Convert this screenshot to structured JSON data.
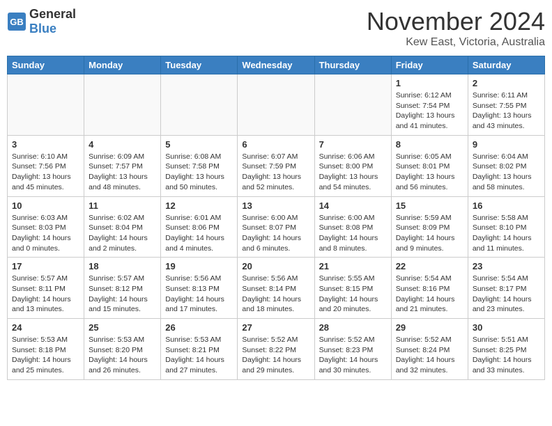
{
  "header": {
    "logo_general": "General",
    "logo_blue": "Blue",
    "month": "November 2024",
    "location": "Kew East, Victoria, Australia"
  },
  "days_of_week": [
    "Sunday",
    "Monday",
    "Tuesday",
    "Wednesday",
    "Thursday",
    "Friday",
    "Saturday"
  ],
  "weeks": [
    [
      {
        "day": "",
        "info": ""
      },
      {
        "day": "",
        "info": ""
      },
      {
        "day": "",
        "info": ""
      },
      {
        "day": "",
        "info": ""
      },
      {
        "day": "",
        "info": ""
      },
      {
        "day": "1",
        "info": "Sunrise: 6:12 AM\nSunset: 7:54 PM\nDaylight: 13 hours\nand 41 minutes."
      },
      {
        "day": "2",
        "info": "Sunrise: 6:11 AM\nSunset: 7:55 PM\nDaylight: 13 hours\nand 43 minutes."
      }
    ],
    [
      {
        "day": "3",
        "info": "Sunrise: 6:10 AM\nSunset: 7:56 PM\nDaylight: 13 hours\nand 45 minutes."
      },
      {
        "day": "4",
        "info": "Sunrise: 6:09 AM\nSunset: 7:57 PM\nDaylight: 13 hours\nand 48 minutes."
      },
      {
        "day": "5",
        "info": "Sunrise: 6:08 AM\nSunset: 7:58 PM\nDaylight: 13 hours\nand 50 minutes."
      },
      {
        "day": "6",
        "info": "Sunrise: 6:07 AM\nSunset: 7:59 PM\nDaylight: 13 hours\nand 52 minutes."
      },
      {
        "day": "7",
        "info": "Sunrise: 6:06 AM\nSunset: 8:00 PM\nDaylight: 13 hours\nand 54 minutes."
      },
      {
        "day": "8",
        "info": "Sunrise: 6:05 AM\nSunset: 8:01 PM\nDaylight: 13 hours\nand 56 minutes."
      },
      {
        "day": "9",
        "info": "Sunrise: 6:04 AM\nSunset: 8:02 PM\nDaylight: 13 hours\nand 58 minutes."
      }
    ],
    [
      {
        "day": "10",
        "info": "Sunrise: 6:03 AM\nSunset: 8:03 PM\nDaylight: 14 hours\nand 0 minutes."
      },
      {
        "day": "11",
        "info": "Sunrise: 6:02 AM\nSunset: 8:04 PM\nDaylight: 14 hours\nand 2 minutes."
      },
      {
        "day": "12",
        "info": "Sunrise: 6:01 AM\nSunset: 8:06 PM\nDaylight: 14 hours\nand 4 minutes."
      },
      {
        "day": "13",
        "info": "Sunrise: 6:00 AM\nSunset: 8:07 PM\nDaylight: 14 hours\nand 6 minutes."
      },
      {
        "day": "14",
        "info": "Sunrise: 6:00 AM\nSunset: 8:08 PM\nDaylight: 14 hours\nand 8 minutes."
      },
      {
        "day": "15",
        "info": "Sunrise: 5:59 AM\nSunset: 8:09 PM\nDaylight: 14 hours\nand 9 minutes."
      },
      {
        "day": "16",
        "info": "Sunrise: 5:58 AM\nSunset: 8:10 PM\nDaylight: 14 hours\nand 11 minutes."
      }
    ],
    [
      {
        "day": "17",
        "info": "Sunrise: 5:57 AM\nSunset: 8:11 PM\nDaylight: 14 hours\nand 13 minutes."
      },
      {
        "day": "18",
        "info": "Sunrise: 5:57 AM\nSunset: 8:12 PM\nDaylight: 14 hours\nand 15 minutes."
      },
      {
        "day": "19",
        "info": "Sunrise: 5:56 AM\nSunset: 8:13 PM\nDaylight: 14 hours\nand 17 minutes."
      },
      {
        "day": "20",
        "info": "Sunrise: 5:56 AM\nSunset: 8:14 PM\nDaylight: 14 hours\nand 18 minutes."
      },
      {
        "day": "21",
        "info": "Sunrise: 5:55 AM\nSunset: 8:15 PM\nDaylight: 14 hours\nand 20 minutes."
      },
      {
        "day": "22",
        "info": "Sunrise: 5:54 AM\nSunset: 8:16 PM\nDaylight: 14 hours\nand 21 minutes."
      },
      {
        "day": "23",
        "info": "Sunrise: 5:54 AM\nSunset: 8:17 PM\nDaylight: 14 hours\nand 23 minutes."
      }
    ],
    [
      {
        "day": "24",
        "info": "Sunrise: 5:53 AM\nSunset: 8:18 PM\nDaylight: 14 hours\nand 25 minutes."
      },
      {
        "day": "25",
        "info": "Sunrise: 5:53 AM\nSunset: 8:20 PM\nDaylight: 14 hours\nand 26 minutes."
      },
      {
        "day": "26",
        "info": "Sunrise: 5:53 AM\nSunset: 8:21 PM\nDaylight: 14 hours\nand 27 minutes."
      },
      {
        "day": "27",
        "info": "Sunrise: 5:52 AM\nSunset: 8:22 PM\nDaylight: 14 hours\nand 29 minutes."
      },
      {
        "day": "28",
        "info": "Sunrise: 5:52 AM\nSunset: 8:23 PM\nDaylight: 14 hours\nand 30 minutes."
      },
      {
        "day": "29",
        "info": "Sunrise: 5:52 AM\nSunset: 8:24 PM\nDaylight: 14 hours\nand 32 minutes."
      },
      {
        "day": "30",
        "info": "Sunrise: 5:51 AM\nSunset: 8:25 PM\nDaylight: 14 hours\nand 33 minutes."
      }
    ]
  ]
}
